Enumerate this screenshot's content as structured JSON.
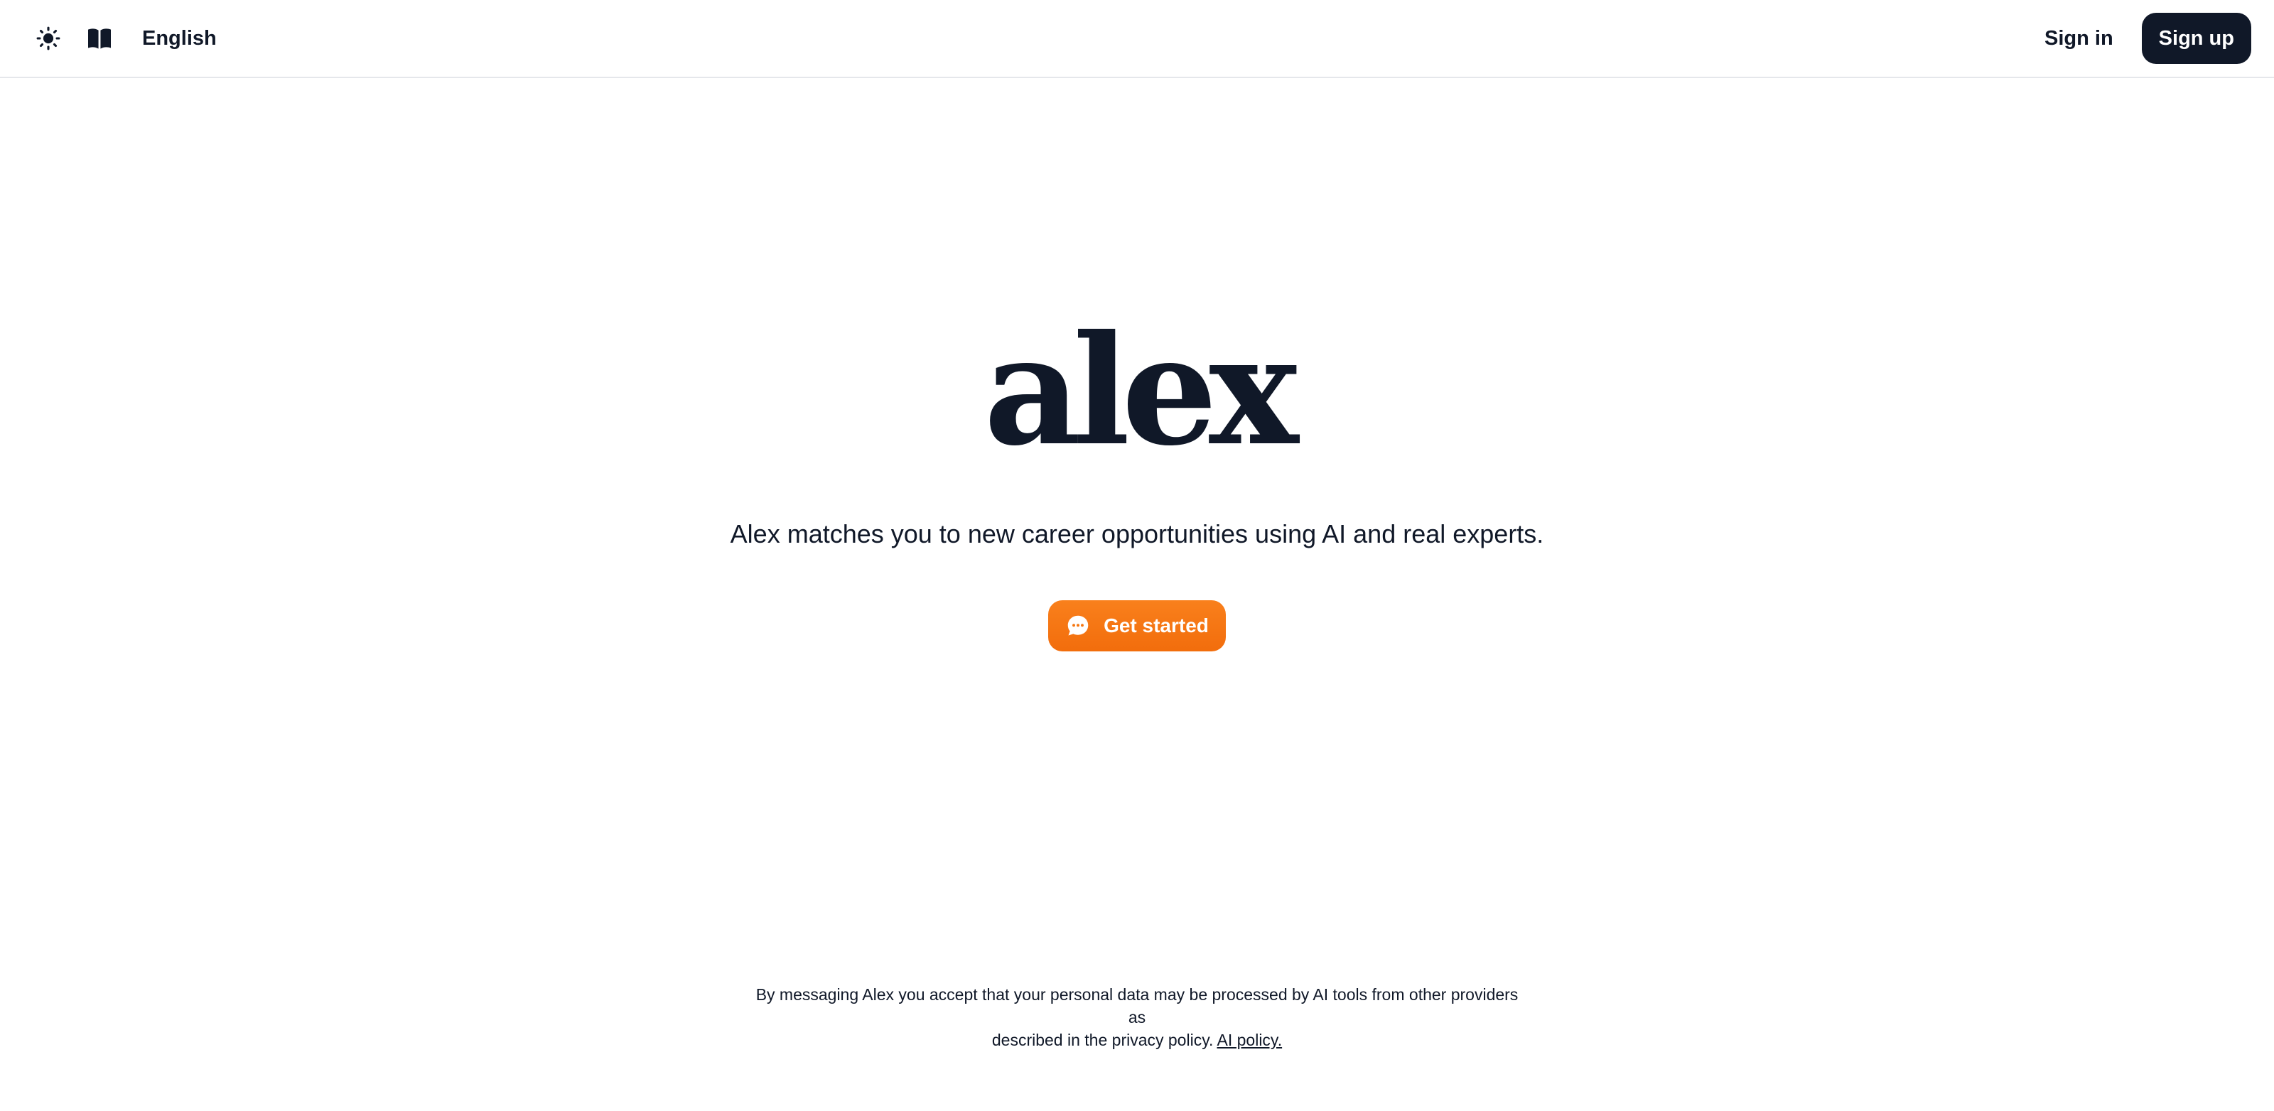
{
  "header": {
    "theme_icon": "sun-icon",
    "docs_icon": "book-icon",
    "language": "English",
    "signin_label": "Sign in",
    "signup_label": "Sign up"
  },
  "hero": {
    "logo_text": "alex",
    "tagline": "Alex matches you to new career opportunities using AI and real experts.",
    "cta_label": "Get started",
    "cta_icon": "chat-bubble-icon"
  },
  "footer": {
    "disclaimer_line1": "By messaging Alex you accept that your personal data may be processed by AI tools from other providers as",
    "disclaimer_line2": "described in the privacy policy.",
    "policy_link": "AI policy."
  },
  "colors": {
    "primary_dark": "#101828",
    "accent_orange": "#f5760f",
    "background": "#ffffff",
    "divider": "#e5e7eb"
  }
}
